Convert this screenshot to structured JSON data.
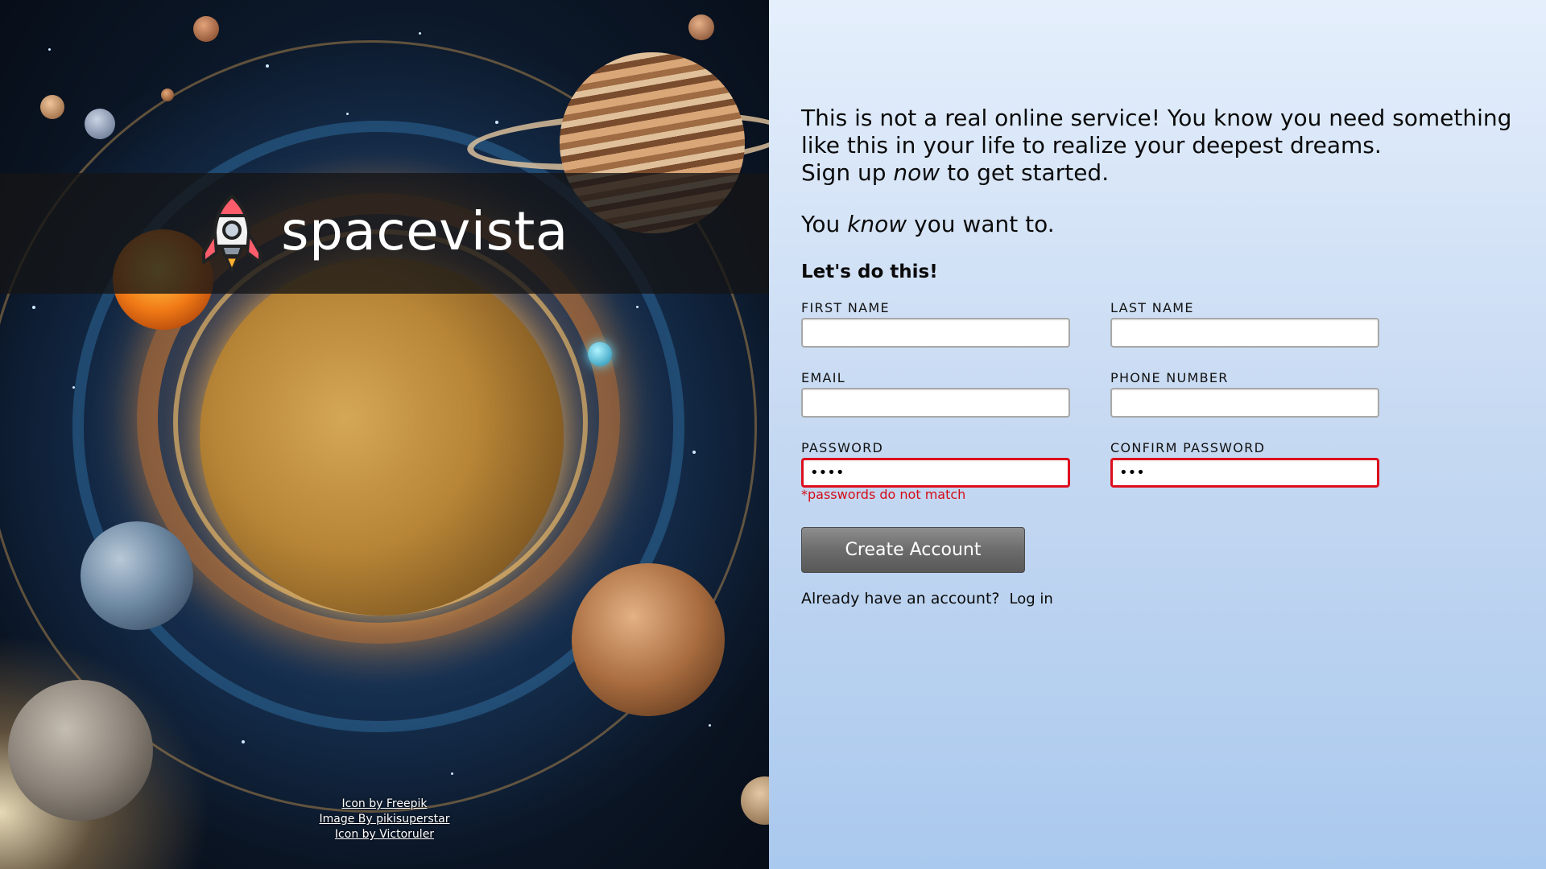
{
  "brand": {
    "name": "spacevista",
    "logo_icon": "rocket-icon"
  },
  "intro": {
    "line1": "This is not a real online service! You know you need something like this in your life to realize your deepest dreams.",
    "line2_pre": "Sign up ",
    "line2_em": "now",
    "line2_post": " to get started.",
    "tag_pre": "You ",
    "tag_em": "know",
    "tag_post": " you want to."
  },
  "form": {
    "heading": "Let's do this!",
    "first_name": {
      "label": "FIRST NAME",
      "value": ""
    },
    "last_name": {
      "label": "LAST NAME",
      "value": ""
    },
    "email": {
      "label": "EMAIL",
      "value": ""
    },
    "phone": {
      "label": "PHONE NUMBER",
      "value": ""
    },
    "password": {
      "label": "PASSWORD",
      "value": "1234"
    },
    "confirm_password": {
      "label": "CONFIRM PASSWORD",
      "value": "123"
    },
    "error": "*passwords do not match",
    "submit_label": "Create Account"
  },
  "login": {
    "prompt": "Already have an account?",
    "link_label": "Log in"
  },
  "credits": [
    "Icon by Freepik",
    "Image By pikisuperstar",
    "Icon by Victoruler"
  ],
  "colors": {
    "error": "#dd0f1e",
    "button": "#6c6c6c",
    "banner": "#141416"
  }
}
